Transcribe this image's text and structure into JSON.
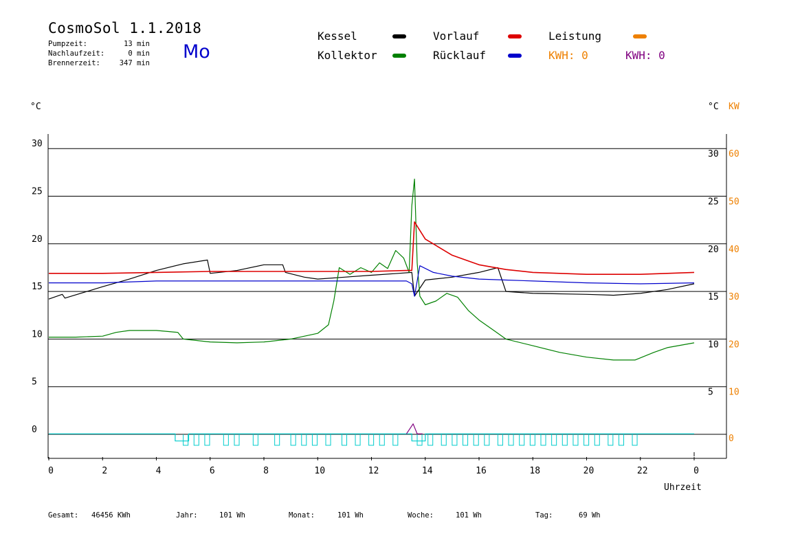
{
  "header": {
    "title": "CosmoSol 1.1.2018",
    "day": "Mo",
    "stats": [
      {
        "label": "Pumpzeit:",
        "value": "13 min"
      },
      {
        "label": "Nachlaufzeit:",
        "value": "0 min"
      },
      {
        "label": "Brennerzeit:",
        "value": "347 min"
      }
    ]
  },
  "legend": {
    "kessel": {
      "label": "Kessel",
      "color": "#000000"
    },
    "kollektor": {
      "label": "Kollektor",
      "color": "#008000"
    },
    "vorlauf": {
      "label": "Vorlauf",
      "color": "#dd0000"
    },
    "ruecklauf": {
      "label": "Rücklauf",
      "color": "#0000cc"
    },
    "leistung": {
      "label": "Leistung",
      "color": "#ee8000"
    },
    "kwh1": {
      "label": "KWH: 0",
      "color": "#ee8000"
    },
    "kwh2": {
      "label": "KWH: 0",
      "color": "#800080"
    }
  },
  "axes": {
    "left_unit": "°C",
    "right_unit": "°C",
    "right_unit2": "KW",
    "x_label": "Uhrzeit"
  },
  "footer": [
    {
      "label": "Gesamt:",
      "value": "46456 KWh"
    },
    {
      "label": "Jahr:",
      "value": "101 Wh"
    },
    {
      "label": "Monat:",
      "value": "101 Wh"
    },
    {
      "label": "Woche:",
      "value": "101 Wh"
    },
    {
      "label": "Tag:",
      "value": "69 Wh"
    }
  ],
  "chart_data": {
    "type": "line",
    "xlabel": "Uhrzeit",
    "ylabel": "°C",
    "xlim": [
      0,
      24
    ],
    "ylim": [
      0,
      31
    ],
    "y2lim": [
      0,
      62
    ],
    "x_ticks": [
      "0",
      "2",
      "4",
      "6",
      "8",
      "10",
      "12",
      "14",
      "16",
      "18",
      "20",
      "22",
      "0"
    ],
    "y_ticks_left": [
      "0",
      "5",
      "10",
      "15",
      "20",
      "25",
      "30"
    ],
    "y_ticks_right": [
      "5",
      "10",
      "15",
      "20",
      "25",
      "30"
    ],
    "y_ticks_right2": [
      "0",
      "10",
      "20",
      "30",
      "40",
      "50",
      "60"
    ],
    "grid": true,
    "series": [
      {
        "name": "Kessel",
        "color": "#000000",
        "x": [
          0,
          0.5,
          0.6,
          2,
          3,
          4,
          5,
          5.9,
          6.0,
          7,
          8,
          8.7,
          8.8,
          9.5,
          10,
          11,
          12,
          13,
          13.5,
          13.6,
          14,
          15,
          16,
          16.7,
          17.0,
          18,
          20,
          21,
          22,
          23,
          24
        ],
        "y": [
          14.2,
          14.7,
          14.3,
          15.5,
          16.3,
          17.2,
          17.9,
          18.3,
          16.9,
          17.2,
          17.8,
          17.8,
          17.0,
          16.5,
          16.3,
          16.5,
          16.7,
          16.9,
          17.0,
          14.5,
          16.2,
          16.5,
          17.0,
          17.5,
          15.0,
          14.8,
          14.7,
          14.6,
          14.8,
          15.2,
          15.8
        ]
      },
      {
        "name": "Kollektor",
        "color": "#008000",
        "x": [
          0,
          1,
          2,
          2.5,
          3,
          4,
          4.8,
          5,
          6,
          7,
          8,
          9,
          10,
          10.4,
          10.6,
          10.8,
          11.2,
          11.6,
          12,
          12.3,
          12.6,
          12.9,
          13.2,
          13.4,
          13.5,
          13.6,
          13.7,
          13.8,
          14,
          14.4,
          14.8,
          15.2,
          15.6,
          16,
          16.6,
          17,
          18,
          19,
          20,
          21,
          21.8,
          22.5,
          23,
          24
        ],
        "y": [
          10.2,
          10.2,
          10.3,
          10.7,
          10.9,
          10.9,
          10.7,
          10.0,
          9.7,
          9.6,
          9.7,
          10.0,
          10.6,
          11.5,
          14.0,
          17.5,
          16.8,
          17.5,
          17.0,
          18.0,
          17.4,
          19.3,
          18.5,
          17.0,
          24.0,
          26.8,
          18.0,
          14.5,
          13.6,
          14.0,
          14.8,
          14.4,
          13.0,
          12.0,
          10.8,
          10.0,
          9.3,
          8.6,
          8.1,
          7.8,
          7.8,
          8.6,
          9.1,
          9.6
        ]
      },
      {
        "name": "Vorlauf",
        "color": "#dd0000",
        "x": [
          0,
          2,
          4,
          6,
          8,
          10,
          12,
          13.3,
          13.5,
          13.6,
          14,
          15,
          16,
          17,
          18,
          20,
          22,
          24
        ],
        "y": [
          16.9,
          16.9,
          17.0,
          17.1,
          17.1,
          17.1,
          17.1,
          17.2,
          17.2,
          22.3,
          20.5,
          18.8,
          17.8,
          17.3,
          17.0,
          16.8,
          16.8,
          17.0
        ]
      },
      {
        "name": "Rücklauf",
        "color": "#0000cc",
        "x": [
          0,
          2,
          4,
          6,
          8,
          10,
          12,
          13.3,
          13.5,
          13.6,
          13.8,
          14.3,
          15,
          16,
          17,
          18,
          20,
          22,
          24
        ],
        "y": [
          15.9,
          15.9,
          16.1,
          16.1,
          16.1,
          16.1,
          16.1,
          16.1,
          15.8,
          14.5,
          17.7,
          17.0,
          16.6,
          16.3,
          16.2,
          16.1,
          15.9,
          15.8,
          15.9
        ]
      },
      {
        "name": "Leistung",
        "color": "#00cccc",
        "x": [
          0,
          4.7,
          4.7,
          5.2,
          5.2,
          13.5,
          13.5,
          14,
          14,
          22,
          22,
          24
        ],
        "y": [
          0.05,
          0.05,
          -0.7,
          -0.7,
          0.05,
          0.05,
          -0.7,
          -0.7,
          0.05,
          0.05,
          0.05,
          0.05
        ]
      },
      {
        "name": "KWH",
        "color": "#800080",
        "x": [
          13.3,
          13.55,
          13.7,
          13.9
        ],
        "y": [
          0.05,
          1.1,
          0.05,
          0.05
        ]
      }
    ]
  }
}
